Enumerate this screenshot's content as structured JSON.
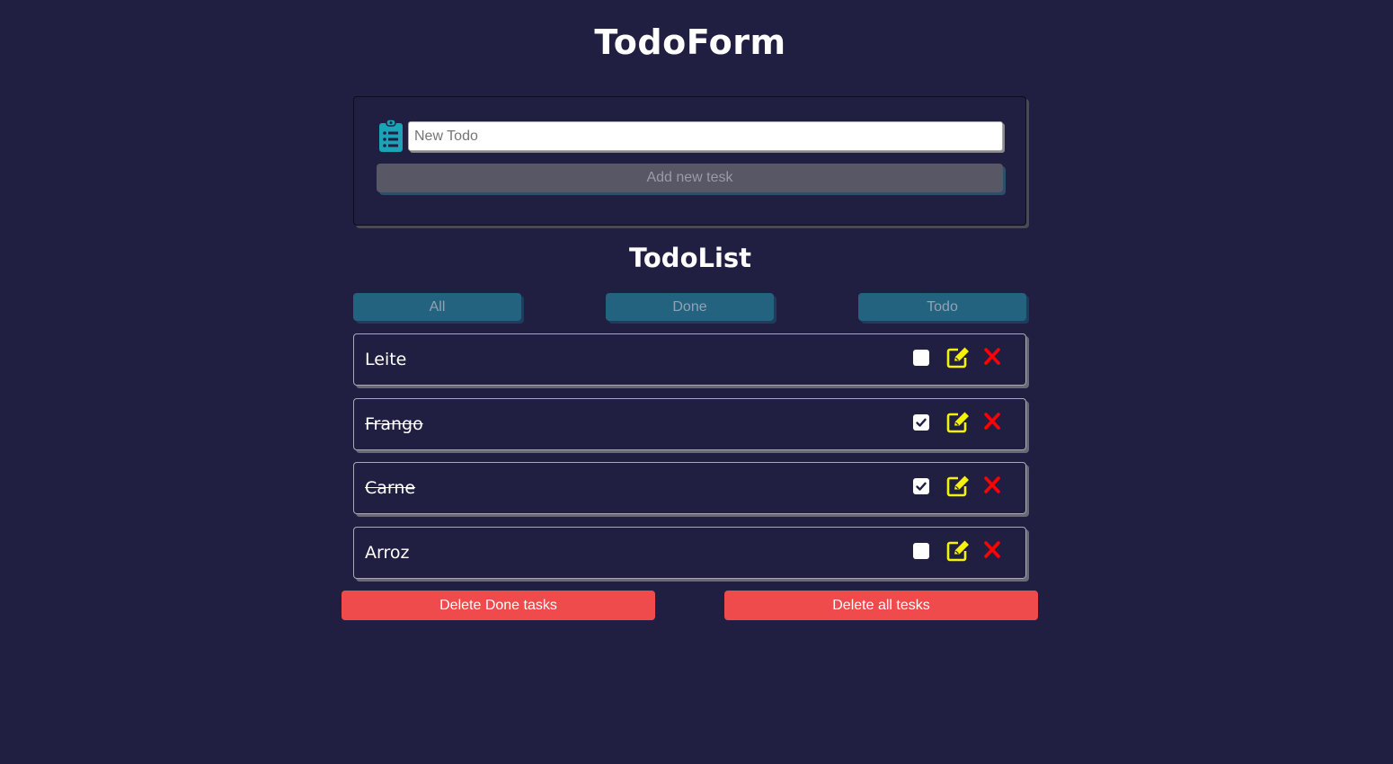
{
  "form": {
    "title": "TodoForm",
    "input_placeholder": "New Todo",
    "input_value": "",
    "add_label": "Add new tesk",
    "icon": "clipboard-list-icon",
    "icon_color": "#1ba3b8"
  },
  "list": {
    "title": "TodoList",
    "filters": [
      "All",
      "Done",
      "Todo"
    ],
    "items": [
      {
        "text": "Leite",
        "done": false
      },
      {
        "text": "Frango",
        "done": true
      },
      {
        "text": "Carne",
        "done": true
      },
      {
        "text": "Arroz",
        "done": false
      }
    ],
    "edit_icon": "edit-icon",
    "edit_color": "#f5f10a",
    "delete_icon": "close-icon",
    "delete_color": "#ff0000"
  },
  "actions": {
    "delete_done_label": "Delete Done tasks",
    "delete_all_label": "Delete all tesks"
  },
  "colors": {
    "background": "#201f42",
    "filter_button": "#24637f",
    "danger": "#ef4a4c"
  }
}
